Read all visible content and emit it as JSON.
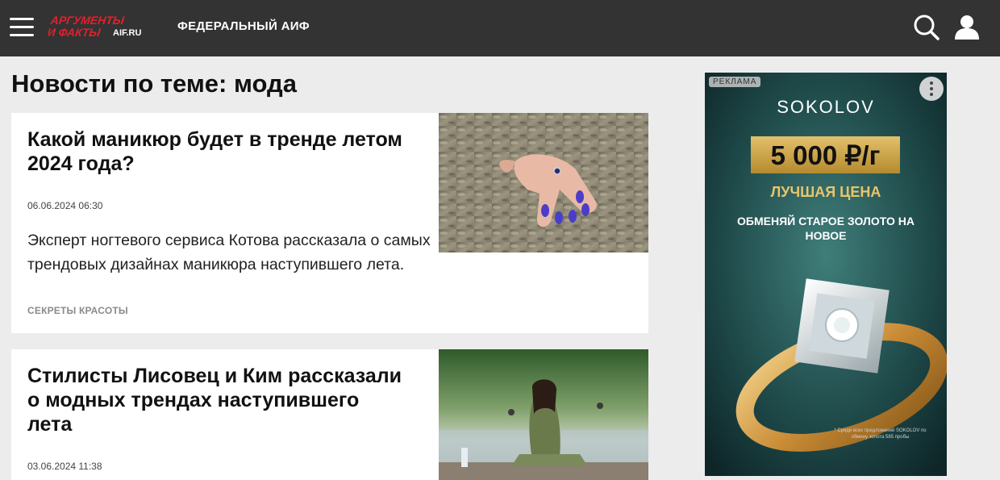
{
  "header": {
    "logo_text_line1": "АРГУМЕНТЫ",
    "logo_text_line2": "И ФАКТЫ",
    "logo_domain": "AIF.RU",
    "section_label": "ФЕДЕРАЛЬНЫЙ АИФ",
    "menu_icon": "hamburger-icon",
    "search_icon": "search-icon",
    "user_icon": "user-icon"
  },
  "page": {
    "title": "Новости по теме: мода"
  },
  "news": [
    {
      "headline": "Какой маникюр будет в тренде летом 2024 года?",
      "date": "06.06.2024 06:30",
      "lead": "Эксперт ногтевого сервиса Котова рассказала о самых трендовых дизайнах маникюра наступившего лета.",
      "rubric": "СЕКРЕТЫ КРАСОТЫ"
    },
    {
      "headline": "Стилисты Лисовец и Ким рассказали о модных трендах наступившего лета",
      "date": "03.06.2024 11:38"
    }
  ],
  "ad": {
    "badge": "РЕКЛАМА",
    "brand": "SOKOLOV",
    "price": "5 000 ₽/г",
    "tagline": "ЛУЧШАЯ ЦЕНА",
    "offer": "ОБМЕНЯЙ СТАРОЕ ЗОЛОТО НА НОВОЕ",
    "fine_print": "* Среди всех предложений SOKOLOV по обмену золота 585 пробы"
  },
  "colors": {
    "header_bg": "#333333",
    "page_bg": "#ececec",
    "logo_red": "#e3202a",
    "rubric_gray": "#8a8a8a",
    "ad_gold": "#d4a94a"
  }
}
